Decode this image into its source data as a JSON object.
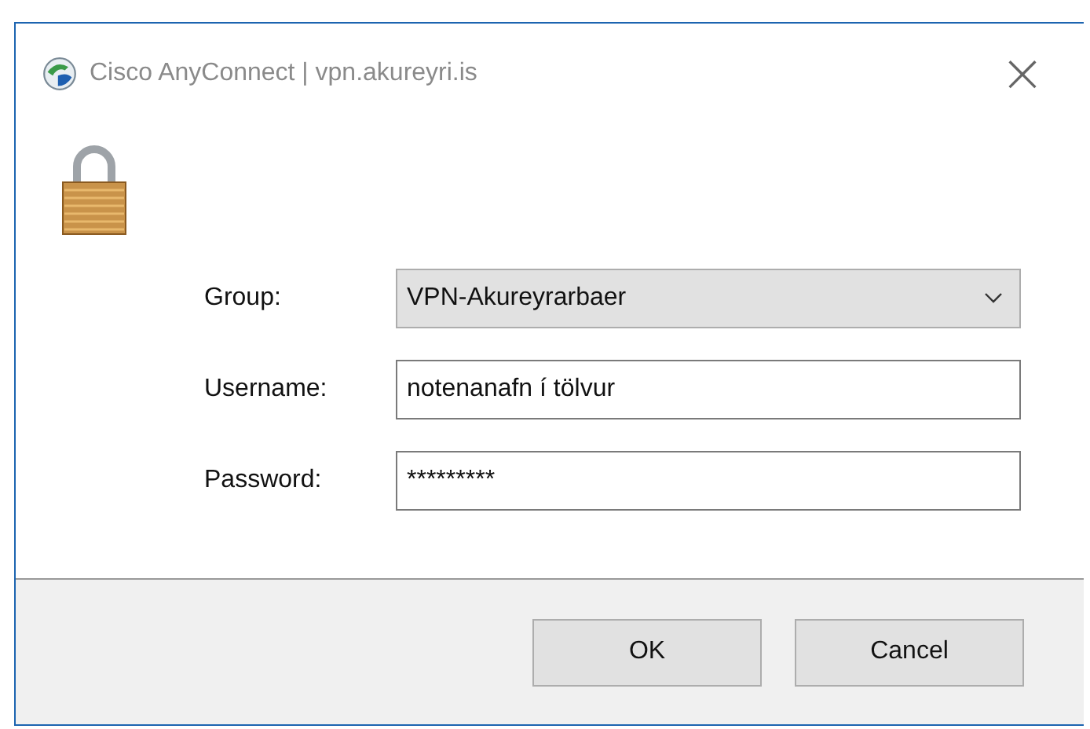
{
  "window": {
    "title": "Cisco AnyConnect | vpn.akureyri.is",
    "close": "×"
  },
  "fields": [
    {
      "kind": "dropdown",
      "label": "Group:",
      "value": "VPN-Akureyrarbaer"
    },
    {
      "kind": "text",
      "label": "Username:",
      "value": "notenanafn í tölvur"
    },
    {
      "kind": "text",
      "label": "Password:",
      "value": "*********"
    }
  ],
  "buttons": [
    "OK",
    "Cancel"
  ]
}
